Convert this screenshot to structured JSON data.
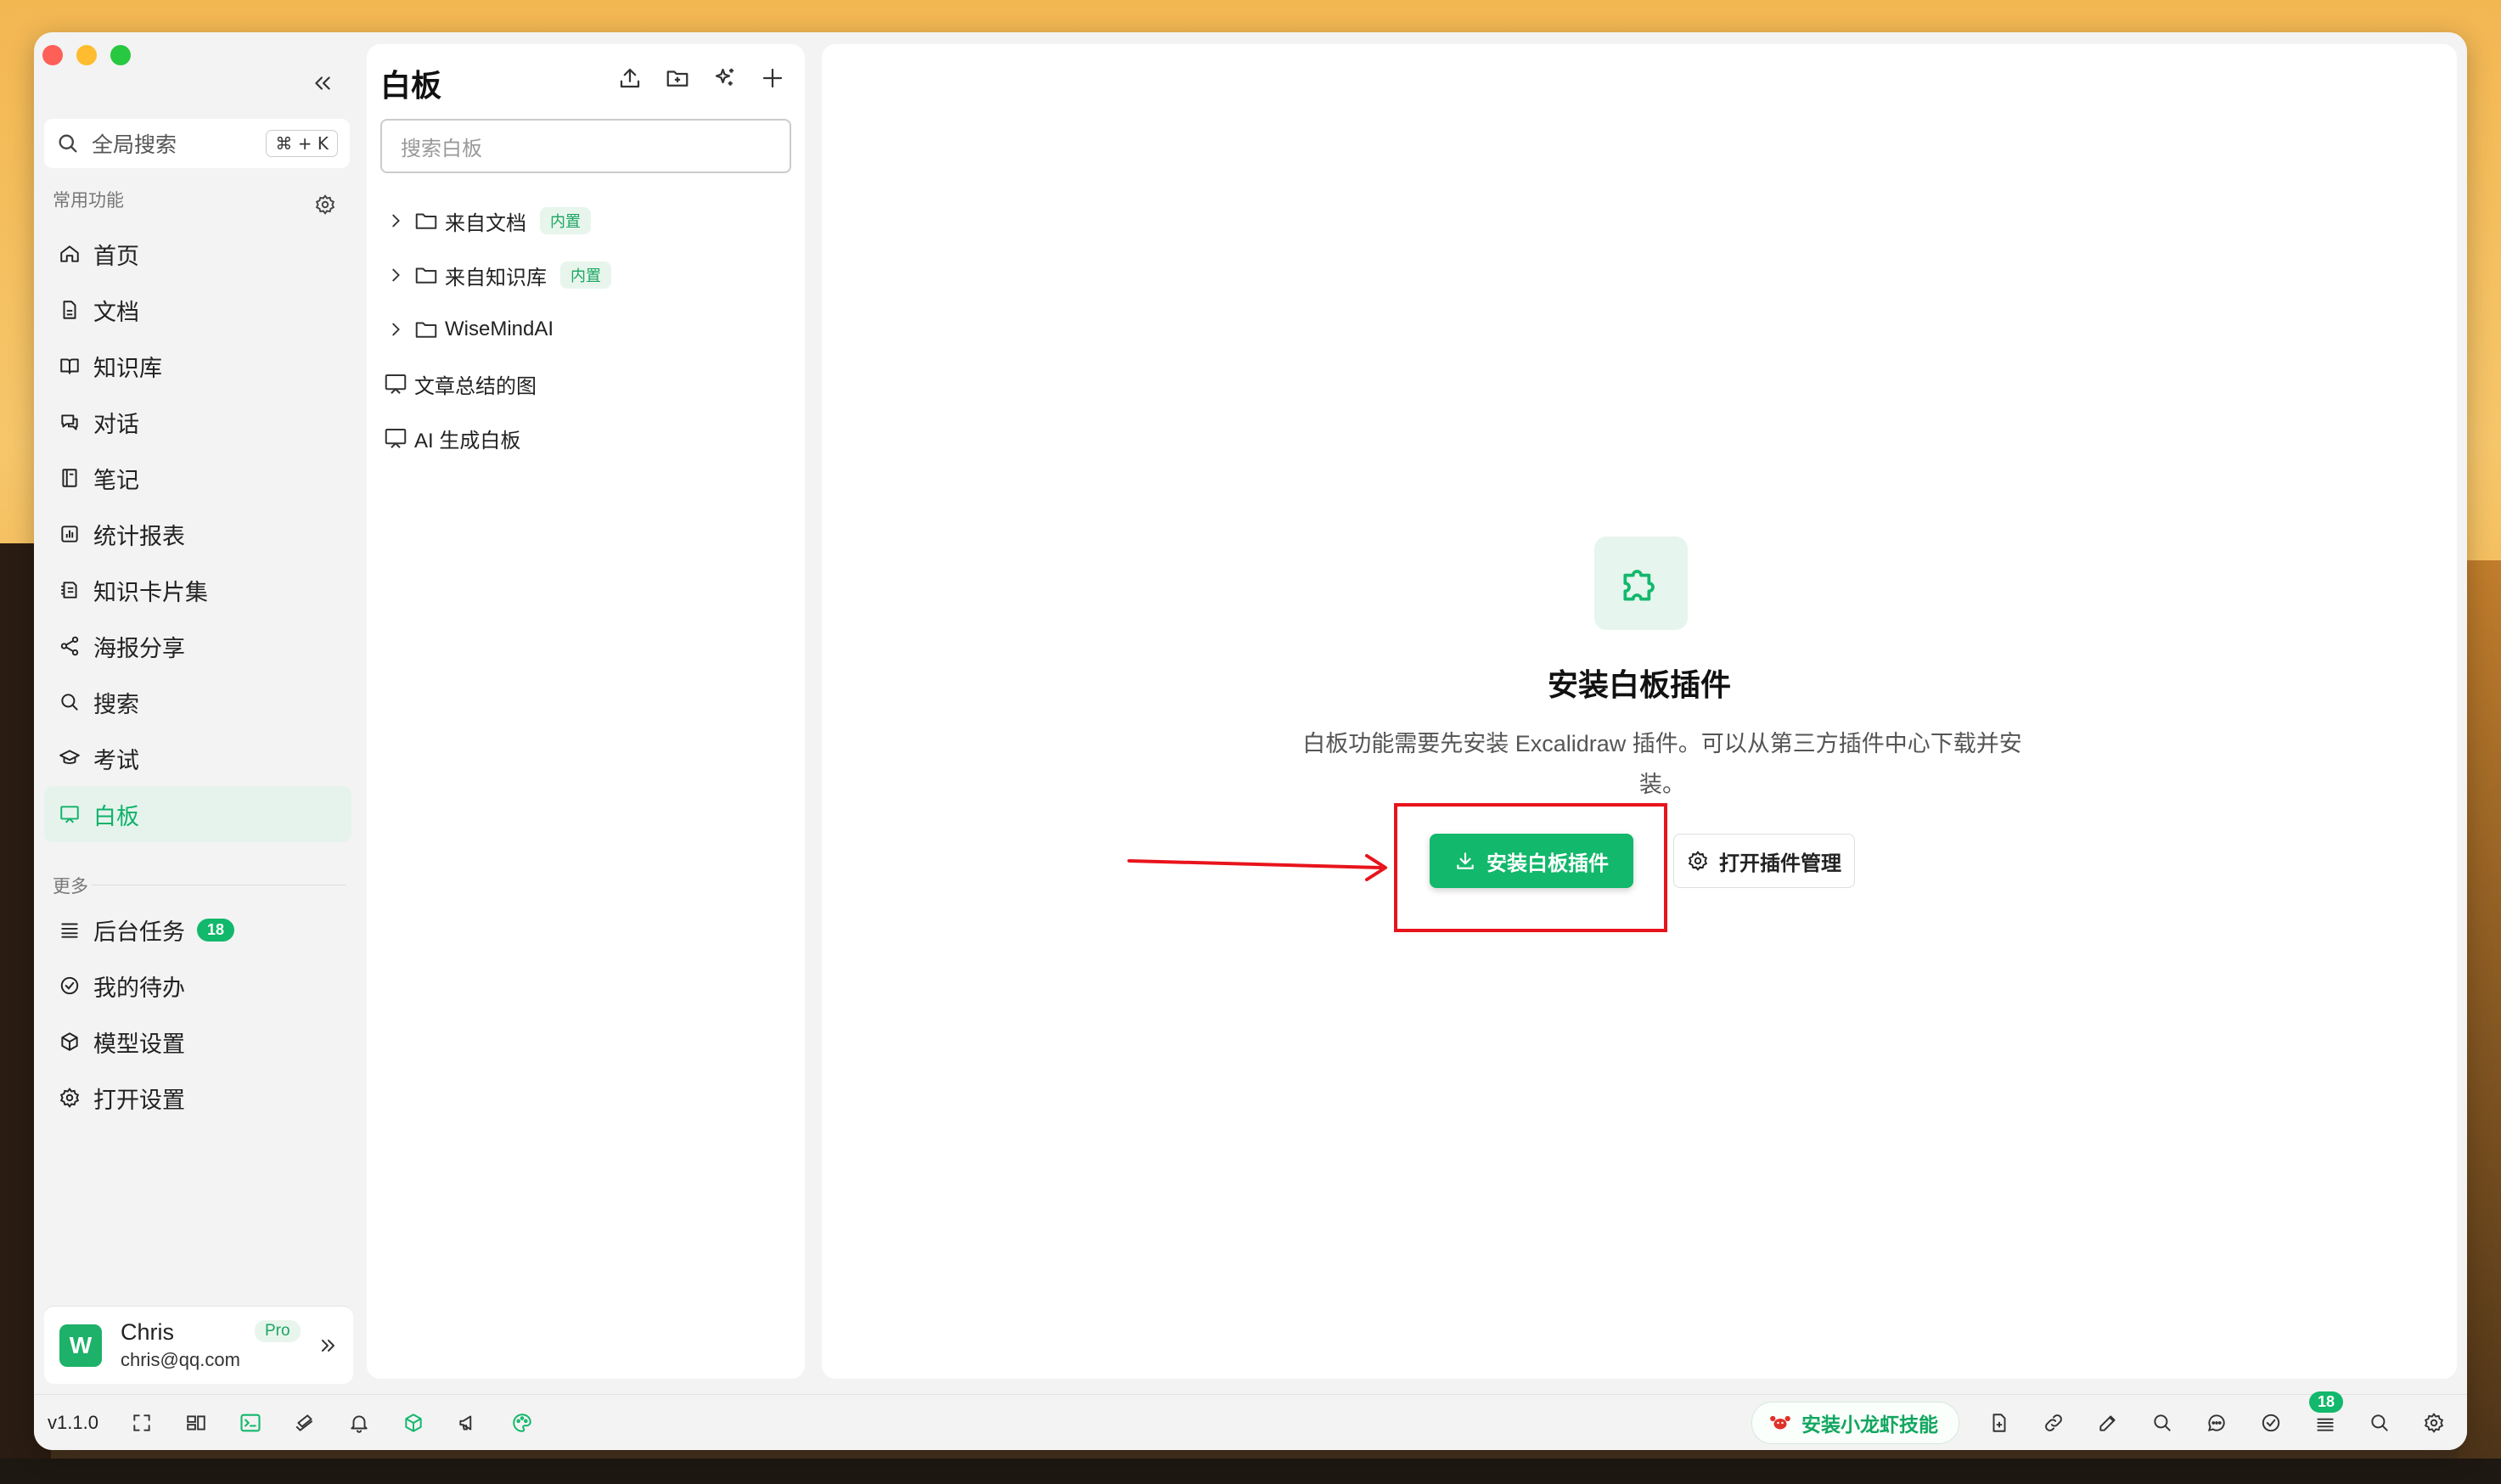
{
  "colors": {
    "accent": "#12b86b",
    "accent_light": "#e6f3ec",
    "annotation_red": "#e8141c"
  },
  "sidebar": {
    "search": {
      "label": "全局搜索",
      "shortcut": "⌘ + K"
    },
    "section_common": "常用功能",
    "items": [
      {
        "label": "首页",
        "icon": "home-icon"
      },
      {
        "label": "文档",
        "icon": "document-icon"
      },
      {
        "label": "知识库",
        "icon": "book-icon"
      },
      {
        "label": "对话",
        "icon": "chat-icon"
      },
      {
        "label": "笔记",
        "icon": "notebook-icon"
      },
      {
        "label": "统计报表",
        "icon": "chart-icon"
      },
      {
        "label": "知识卡片集",
        "icon": "cards-icon"
      },
      {
        "label": "海报分享",
        "icon": "share-icon"
      },
      {
        "label": "搜索",
        "icon": "search-icon"
      },
      {
        "label": "考试",
        "icon": "graduation-icon"
      },
      {
        "label": "白板",
        "icon": "whiteboard-icon",
        "active": true
      }
    ],
    "section_more": "更多",
    "more_items": [
      {
        "label": "后台任务",
        "icon": "list-icon",
        "badge": "18"
      },
      {
        "label": "我的待办",
        "icon": "check-circle-icon"
      },
      {
        "label": "模型设置",
        "icon": "cube-icon"
      },
      {
        "label": "打开设置",
        "icon": "gear-icon"
      }
    ],
    "user": {
      "avatar_letter": "W",
      "name": "Chris",
      "email": "chris@qq.com",
      "plan": "Pro"
    }
  },
  "middle": {
    "title": "白板",
    "search_placeholder": "搜索白板",
    "tree": [
      {
        "label": "来自文档",
        "type": "folder",
        "tag": "内置"
      },
      {
        "label": "来自知识库",
        "type": "folder",
        "tag": "内置"
      },
      {
        "label": "WiseMindAI",
        "type": "folder"
      },
      {
        "label": "文章总结的图",
        "type": "board"
      },
      {
        "label": "AI 生成白板",
        "type": "board"
      }
    ]
  },
  "main": {
    "empty_title": "安装白板插件",
    "empty_desc": "白板功能需要先安装 Excalidraw 插件。可以从第三方插件中心下载并安装。",
    "install_button": "安装白板插件",
    "manage_button": "打开插件管理"
  },
  "status_bar": {
    "version": "v1.1.0",
    "skill_button": "安装小龙虾技能",
    "notification_count": "18"
  }
}
